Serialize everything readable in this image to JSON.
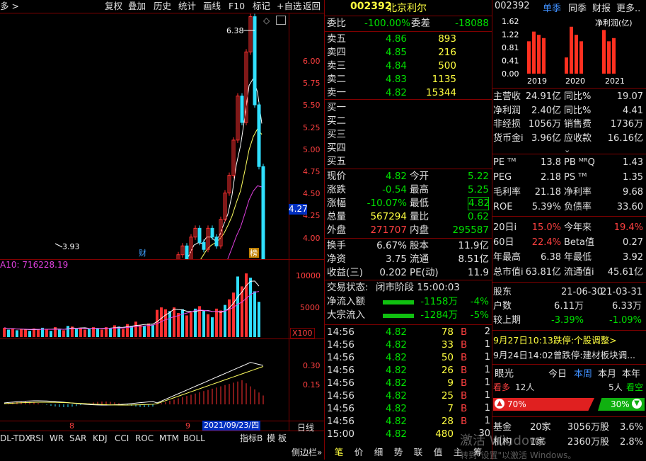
{
  "toolbar": {
    "left_label": "多 >",
    "buttons": [
      "复权",
      "叠加",
      "历史",
      "统计",
      "画线",
      "F10",
      "标记",
      "+自选",
      "返回"
    ]
  },
  "chart": {
    "high_label": "6.38",
    "low_label": "3.93",
    "price_axis": [
      "6.00",
      "5.75",
      "5.50",
      "5.25",
      "5.00",
      "4.75",
      "4.50",
      "4.25",
      "4.00"
    ],
    "current_price_tag": "4.27",
    "marker_cai": "财",
    "marker_bang": "榜",
    "vol_label": "A10: 716228.19",
    "vol_axis": [
      "10000",
      "5000"
    ],
    "vol_unit": "X100",
    "macd_axis": [
      "0.30",
      "0.15"
    ],
    "date_marks": [
      "8",
      "9"
    ],
    "date_highlight": "2021/09/23/四",
    "period": "日线",
    "indicator_tabs": [
      "DL-TDX",
      "RSI",
      "WR",
      "SAR",
      "KDJ",
      "CCI",
      "ROC",
      "MTM",
      "BOLL"
    ],
    "bottom_right": [
      "指标B",
      "模",
      "板"
    ],
    "sidebar_tab": "侧边栏»",
    "bottom_tabs": [
      "笔",
      "价",
      "细",
      "势",
      "联",
      "值",
      "主",
      "筹"
    ],
    "volume_bars": [
      {
        "v": 1500,
        "up": true
      },
      {
        "v": 1200,
        "up": false
      },
      {
        "v": 1400,
        "up": true
      },
      {
        "v": 1100,
        "up": false
      },
      {
        "v": 1300,
        "up": true
      },
      {
        "v": 1200,
        "up": true
      },
      {
        "v": 1000,
        "up": false
      },
      {
        "v": 1400,
        "up": true
      },
      {
        "v": 1200,
        "up": true
      },
      {
        "v": 1500,
        "up": false
      },
      {
        "v": 1300,
        "up": true
      },
      {
        "v": 1000,
        "up": false
      },
      {
        "v": 1600,
        "up": true
      },
      {
        "v": 1200,
        "up": false
      },
      {
        "v": 1100,
        "up": true
      },
      {
        "v": 1800,
        "up": false
      },
      {
        "v": 1700,
        "up": true
      },
      {
        "v": 1300,
        "up": false
      },
      {
        "v": 1500,
        "up": true
      },
      {
        "v": 1200,
        "up": true
      },
      {
        "v": 1300,
        "up": false
      },
      {
        "v": 1600,
        "up": true
      },
      {
        "v": 1400,
        "up": false
      },
      {
        "v": 1200,
        "up": true
      },
      {
        "v": 1600,
        "up": true
      },
      {
        "v": 1400,
        "up": false
      },
      {
        "v": 1900,
        "up": true
      },
      {
        "v": 1700,
        "up": false
      },
      {
        "v": 1300,
        "up": true
      },
      {
        "v": 2100,
        "up": true
      },
      {
        "v": 1800,
        "up": false
      },
      {
        "v": 2500,
        "up": true
      },
      {
        "v": 2000,
        "up": true
      },
      {
        "v": 1800,
        "up": false
      },
      {
        "v": 2200,
        "up": true
      },
      {
        "v": 2000,
        "up": false
      },
      {
        "v": 4400,
        "up": true
      },
      {
        "v": 4800,
        "up": true
      },
      {
        "v": 4500,
        "up": true
      },
      {
        "v": 4200,
        "up": false
      },
      {
        "v": 4800,
        "up": true
      },
      {
        "v": 3900,
        "up": true
      },
      {
        "v": 4500,
        "up": false
      },
      {
        "v": 3500,
        "up": true
      },
      {
        "v": 4000,
        "up": true
      },
      {
        "v": 4600,
        "up": false
      },
      {
        "v": 5000,
        "up": true
      },
      {
        "v": 4200,
        "up": false
      },
      {
        "v": 3700,
        "up": true
      },
      {
        "v": 3200,
        "up": false
      },
      {
        "v": 4600,
        "up": true
      },
      {
        "v": 4300,
        "up": true
      },
      {
        "v": 5200,
        "up": false
      },
      {
        "v": 6100,
        "up": true
      },
      {
        "v": 7200,
        "up": true
      },
      {
        "v": 9800,
        "up": false
      },
      {
        "v": 8200,
        "up": true
      },
      {
        "v": 10300,
        "up": true
      },
      {
        "v": 9600,
        "up": false
      },
      {
        "v": 7400,
        "up": false
      },
      {
        "v": 5700,
        "up": false
      }
    ]
  },
  "quote": {
    "code": "002392",
    "name": "北京利尔",
    "weibi_label": "委比",
    "weibi": "-100.00%",
    "weicha_label": "委差",
    "weicha": "-18088",
    "asks": [
      {
        "label": "卖五",
        "price": "4.86",
        "vol": "893"
      },
      {
        "label": "卖四",
        "price": "4.85",
        "vol": "216"
      },
      {
        "label": "卖三",
        "price": "4.84",
        "vol": "500"
      },
      {
        "label": "卖二",
        "price": "4.83",
        "vol": "1135"
      },
      {
        "label": "卖一",
        "price": "4.82",
        "vol": "15344"
      }
    ],
    "bids": [
      "买一",
      "买二",
      "买三",
      "买四",
      "买五"
    ],
    "stats": [
      {
        "l1": "现价",
        "v1": "4.82",
        "c1": "g",
        "l2": "今开",
        "v2": "5.22",
        "c2": "g"
      },
      {
        "l1": "涨跌",
        "v1": "-0.54",
        "c1": "g",
        "l2": "最高",
        "v2": "5.25",
        "c2": "g"
      },
      {
        "l1": "涨幅",
        "v1": "-10.07%",
        "c1": "g",
        "l2": "最低",
        "v2": "4.82",
        "c2": "g"
      },
      {
        "l1": "总量",
        "v1": "567294",
        "c1": "y",
        "l2": "量比",
        "v2": "0.62",
        "c2": "g"
      },
      {
        "l1": "外盘",
        "v1": "271707",
        "c1": "r",
        "l2": "内盘",
        "v2": "295587",
        "c2": "g"
      }
    ],
    "stats2": [
      {
        "l1": "换手",
        "v1": "6.67%",
        "l2": "股本",
        "v2": "11.9亿"
      },
      {
        "l1": "净资",
        "v1": "3.75",
        "l2": "流通",
        "v2": "8.51亿"
      },
      {
        "l1": "收益(三)",
        "v1": "0.202",
        "l2": "PE(动)",
        "v2": "11.9"
      }
    ],
    "trade_status_label": "交易状态:",
    "trade_status": "闭市阶段 15:00:03",
    "flows": [
      {
        "label": "净流入额",
        "value": "-1158万",
        "pct": "-4%"
      },
      {
        "label": "大宗流入",
        "value": "-1284万",
        "pct": "-5%"
      }
    ],
    "ticks": [
      {
        "t": "14:56",
        "p": "4.82",
        "v": "78",
        "s": "B",
        "n": "2"
      },
      {
        "t": "14:56",
        "p": "4.82",
        "v": "33",
        "s": "B",
        "n": "1"
      },
      {
        "t": "14:56",
        "p": "4.82",
        "v": "50",
        "s": "B",
        "n": "1"
      },
      {
        "t": "14:56",
        "p": "4.82",
        "v": "26",
        "s": "B",
        "n": "1"
      },
      {
        "t": "14:56",
        "p": "4.82",
        "v": "9",
        "s": "B",
        "n": "1"
      },
      {
        "t": "14:56",
        "p": "4.82",
        "v": "25",
        "s": "B",
        "n": "1"
      },
      {
        "t": "14:56",
        "p": "4.82",
        "v": "7",
        "s": "B",
        "n": "1"
      },
      {
        "t": "14:56",
        "p": "4.82",
        "v": "28",
        "s": "B",
        "n": "1"
      },
      {
        "t": "15:00",
        "p": "4.82",
        "v": "480",
        "s": "",
        "n": "30"
      }
    ]
  },
  "finance": {
    "code": "002392",
    "tabs": [
      "单季",
      "同季",
      "财报",
      "更多.."
    ],
    "mini_chart": {
      "yaxis": [
        "1.62",
        "1.22",
        "0.81",
        "0.41",
        "0.00"
      ],
      "years": [
        "2019",
        "2020",
        "2021"
      ],
      "legend": "净利润(亿)",
      "values": [
        1.0,
        1.3,
        1.2,
        1.1,
        0.5,
        1.45,
        1.2,
        1.0,
        1.35,
        1.0,
        1.1
      ]
    },
    "rows1": [
      {
        "l1": "主营收",
        "v1": "24.91亿",
        "l2": "同比%",
        "v2": "19.07"
      },
      {
        "l1": "净利润",
        "v1": "2.40亿",
        "l2": "同比%",
        "v2": "4.41"
      },
      {
        "l1": "非经损",
        "v1": "1056万",
        "l2": "销售费",
        "v2": "1736万"
      },
      {
        "l1": "货币金i",
        "v1": "3.96亿",
        "l2": "应收款",
        "v2": "16.16亿"
      }
    ],
    "rows2": [
      {
        "l1": "PE ᵀᴹ",
        "v1": "13.8",
        "l2": "PB ᴹᴿQ",
        "v2": "1.43"
      },
      {
        "l1": "PEG",
        "v1": "2.18",
        "l2": "PS ᵀᴹ",
        "v2": "1.35"
      },
      {
        "l1": "毛利率",
        "v1": "21.18",
        "l2": "净利率",
        "v2": "9.68"
      },
      {
        "l1": "ROE",
        "v1": "5.39%",
        "l2": "负债率",
        "v2": "33.60"
      }
    ],
    "rows3": [
      {
        "l1": "20日i",
        "v1": "15.0%",
        "l2": "今年来",
        "v2": "19.4%",
        "c1": "r",
        "c2": "r"
      },
      {
        "l1": "60日",
        "v1": "22.4%",
        "l2": "Beta值",
        "v2": "0.27",
        "c1": "r",
        "c2": "w"
      },
      {
        "l1": "年最高",
        "v1": "6.38",
        "l2": "年最低",
        "v2": "3.92",
        "c1": "w",
        "c2": "w"
      },
      {
        "l1": "总市值i",
        "v1": "63.81亿",
        "l2": "流通值i",
        "v2": "45.61亿",
        "c1": "w",
        "c2": "w"
      }
    ],
    "holders_head": {
      "l": "股东",
      "d1": "21-06-30",
      "d2": "21-03-31"
    },
    "holders": [
      {
        "l": "户数",
        "v1": "6.11万",
        "v2": "6.33万"
      },
      {
        "l": "较上期",
        "v1": "-3.39%",
        "v2": "-1.09%"
      }
    ],
    "news": [
      "9月27日10:13跌停:个股调整>",
      "9月24日14:02曾跌停:建材板块调..."
    ],
    "view_label": "眼光",
    "view_tabs": [
      "今日",
      "本周",
      "本月",
      "本年"
    ],
    "bull_label": "看多",
    "bull_count": "12人",
    "bear_count": "5人",
    "bear_label": "看空",
    "bull_pct": "70%",
    "bear_pct": "30%",
    "funds": [
      {
        "l": "基金",
        "n": "20家",
        "v": "3056万股",
        "p": "3.6%"
      },
      {
        "l": "机构",
        "n": "1家",
        "v": "2360万股",
        "p": "2.8%"
      }
    ]
  },
  "watermark": {
    "line1": "激活 Windows",
    "line2": "转到\"设置\"以激活 Windows。"
  }
}
